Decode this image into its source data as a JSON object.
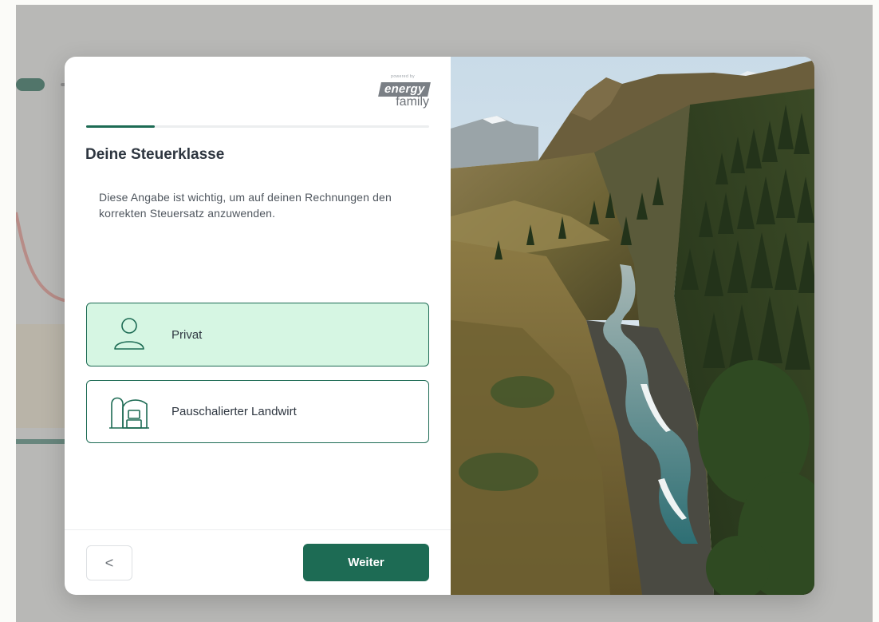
{
  "brand": {
    "powered_by": "powered by",
    "word_1": "energy",
    "word_2": "family"
  },
  "wizard": {
    "progress_fraction": 0.2,
    "title": "Deine Steuerklasse",
    "description": "Diese Angabe ist wichtig, um auf deinen Rechnungen den korrekten Steuersatz anzuwenden.",
    "options": [
      {
        "label": "Privat",
        "icon": "person-icon",
        "selected": true
      },
      {
        "label": "Pauschalierter Landwirt",
        "icon": "barn-icon",
        "selected": false
      }
    ],
    "back_label": "<",
    "next_label": "Weiter"
  },
  "colors": {
    "accent": "#1d6b54",
    "selected_bg": "#d6f6e3",
    "overlay": "#808080"
  }
}
